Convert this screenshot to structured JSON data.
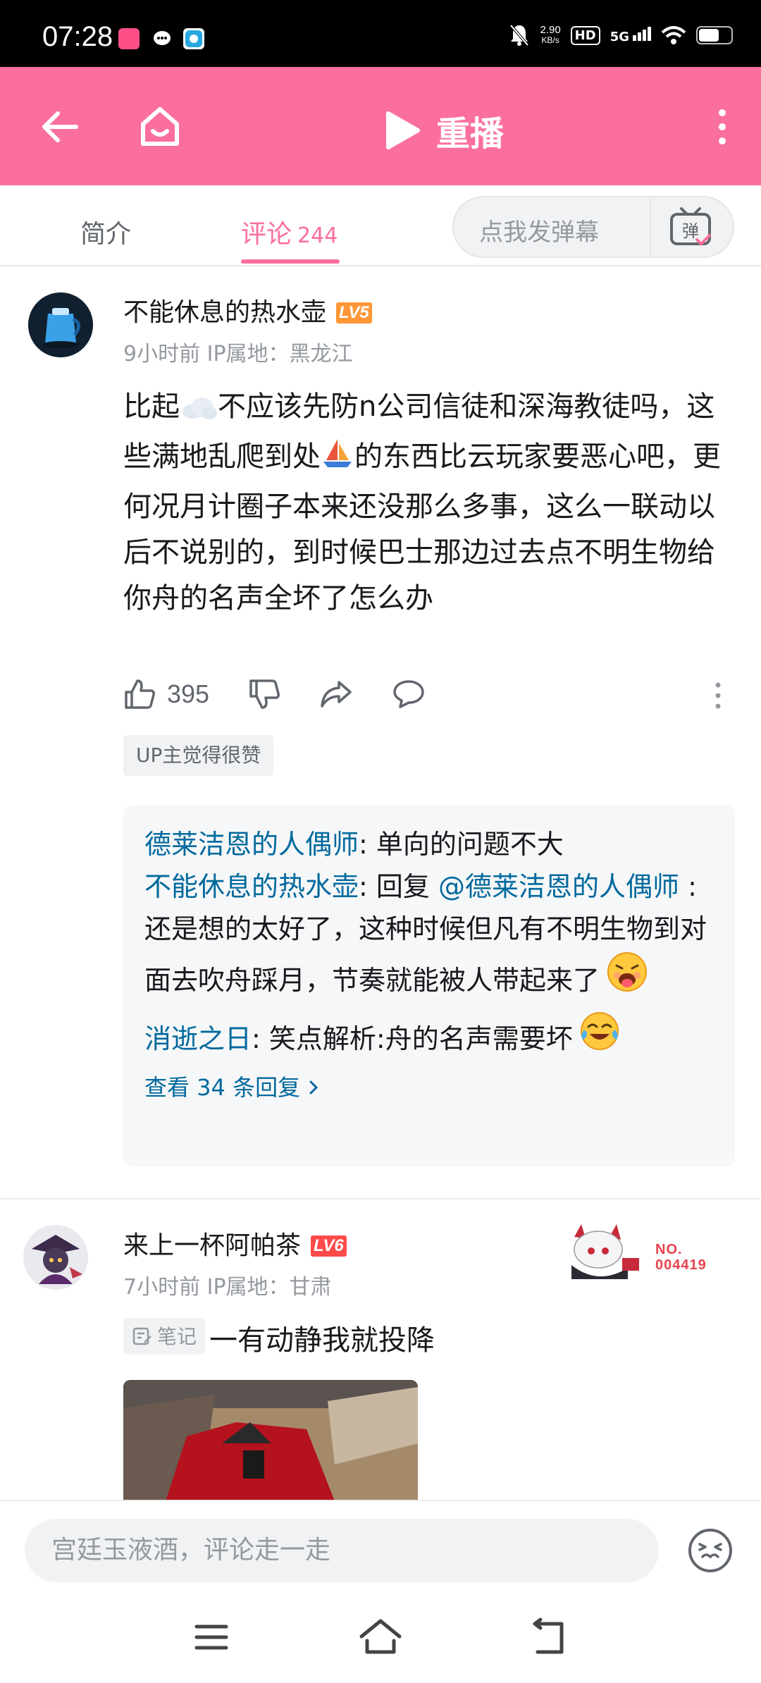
{
  "status_bar": {
    "time": "07:28",
    "net_speed_value": "2.90",
    "net_speed_unit": "KB/s",
    "hd_label": "HD",
    "network_label": "5G"
  },
  "header": {
    "title": "重播"
  },
  "tabs": {
    "intro_label": "简介",
    "comments_label": "评论",
    "comments_count": "244",
    "danmaku_placeholder": "点我发弹幕",
    "danmaku_icon_text": "弹"
  },
  "comments": [
    {
      "username": "不能休息的热水壶",
      "level": "LV5",
      "level_color": "#ff9736",
      "meta": "9小时前 IP属地：黑龙江",
      "content_parts": [
        "比起",
        "不应该先防n公司信徒和深海教徒吗，这些满地乱爬到处",
        "的东西比云玩家要恶心吧，更何况月计圈子本来还没那么多事，这么一联动以后不说别的，到时候巴士那边过去点不明生物给你舟的名声全坏了怎么办"
      ],
      "likes": "395",
      "up_tag": "UP主觉得很赞",
      "replies": [
        {
          "name": "德莱洁恩的人偶师",
          "sep": ": ",
          "text": "单向的问题不大"
        },
        {
          "name": "不能休息的热水壶",
          "sep": ": ",
          "pre": "回复 ",
          "mention": "@德莱洁恩的人偶师",
          "text": " :还是想的太好了，这种时候但凡有不明生物到对面去吹舟踩月，节奏就能被人带起来了"
        },
        {
          "name": "消逝之日",
          "sep": ": ",
          "text": "笑点解析:舟的名声需要坏"
        }
      ],
      "view_more": "查看 34 条回复"
    },
    {
      "username": "来上一杯阿帕茶",
      "level": "LV6",
      "level_color": "#ff4a4a",
      "meta": "7小时前 IP属地：甘肃",
      "fan_no_label": "NO.",
      "fan_no_value": "004419",
      "note_tag": "笔记",
      "content": "一有动静我就投降"
    }
  ],
  "input": {
    "placeholder": "宫廷玉液酒，评论走一走"
  },
  "icons": {
    "back": "back-arrow-icon",
    "home": "home-icon",
    "play": "play-icon",
    "more": "more-vertical-icon",
    "like": "thumb-up-icon",
    "dislike": "thumb-down-icon",
    "share": "share-icon",
    "reply": "comment-bubble-icon",
    "emoji": "emoji-icon"
  },
  "colors": {
    "brand_pink": "#fb6f9d",
    "link_blue": "#00699d"
  }
}
